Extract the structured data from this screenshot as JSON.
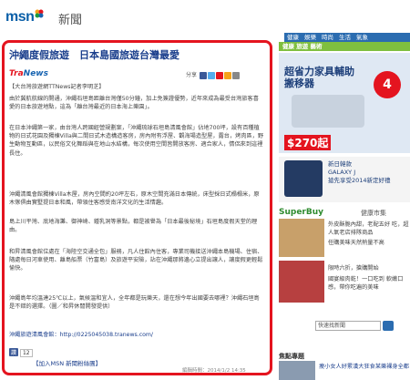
{
  "header": {
    "logo": "msn",
    "section": "新聞"
  },
  "topnav": [
    "健康",
    "娛樂",
    "時尚",
    "生活",
    "氣象"
  ],
  "article": {
    "headline": "沖繩度假旅遊　日本島國旅遊台灣最愛",
    "source_tra": "Tra",
    "source_news": "News",
    "share_label": "分享",
    "paragraphs": [
      "【大台灣旅遊網TTNews記者李明芝】",
      "由於冀航航線的開通，沖繩石垣島距離台灣僅50分鐘，加上免簽證優勢，近年來成為最受台灣旅客喜愛的日本旅遊地點，這為「離台灣最近的日本海上樂園」。",
      "在日本沖繩第一家，由台灣人跨國經營規劃案，「沖繩琉球石垣島清風會館」佔地700坪，設有百種植物的日式花園及獨棟Villa與二間日式木造構造客房，房內附有浮屋、觀海場造型屋，露台，烤肉區，野生動物互動區，以民俗文化舞蹈與在地山水結構，每次使用空間皆開放客房、適合家人，情侶來到這裡長住。",
      "沖繩清風會館獨棟Villa木屋，房內空間約20坪左右，原木空間充滿日本傳統，床型採日式榻榻米，原木傢俱由實墅提日本和風，帶領住客感受南洋文化的生活情趣。",
      "島上川平灣、底地海灘、御神崎、鍾乳洞等景點，都是被譽為「日本最後秘境」石垣島度假天堂的理由。",
      "和昇清風會館位處在「海陸空交通全包」服務，凡人住館內住客，專業司機接送沖繩本島機場、住宿、隨處每日河車使用、離島船票（竹富島）及旅遊平安險，站在沖繩那將邊心立提出讓人，讓度假更輕鬆愉快。",
      "沖繩島年均溫達25℃以上，氣候溫和宜人，全年都是玩樂天，還在想今年出國要去哪裡？沖繩石垣島是不錯的選擇。（圖／和昇休閒開發提供）",
      "沖繩旅遊清風會館：http://0225045038.tranews.com/"
    ],
    "fb_like": "讚",
    "fb_count": "12",
    "join_link": "【加入MSN 新聞粉絲團】",
    "editor": "編輯時間：2014/1/2 14:35"
  },
  "right": {
    "header": "健康 旅遊 藝術",
    "ad1": {
      "title_line1": "超省力家具輔助",
      "title_line2": "搬移器",
      "badge": "4",
      "price": "$270起"
    },
    "ad2": {
      "line1": "新日韓款",
      "line2": "GALAXY J",
      "line3": "搶先享受2014新定好禮"
    },
    "superbuy": {
      "title": "SuperBuy",
      "subtitle": "健康市集",
      "items": [
        "外皮酥脆內甜，老配五好 吃，超人氣老店排隊商品",
        "任購美味天然熱量不高",
        "限時六折，搶購開始",
        "國宴級肉乾！一口吃到 軟嫩口感，帶你吃遍的美味"
      ]
    },
    "search_placeholder": "快速找新聞",
    "focus_title": "焦點專題",
    "focus_text": "瘦小女人好累漢大狂食某樂裸身全都"
  },
  "colors": {
    "accent_red": "#e4141f",
    "link_blue": "#1a3e8c",
    "nav_blue": "#2b6cb0",
    "green": "#7fbf3f"
  }
}
